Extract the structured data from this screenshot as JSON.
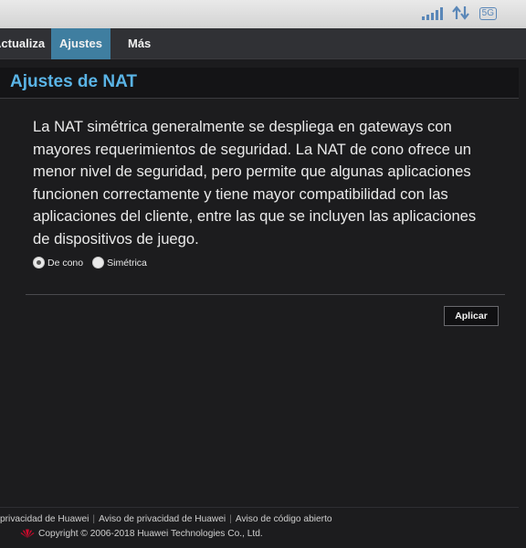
{
  "status_bar": {
    "icons": [
      "signal-bars-icon",
      "up-down-arrows-icon",
      "5g-badge-icon"
    ],
    "badge_5g": "5G",
    "accent_color": "#5a87b8"
  },
  "nav": {
    "items": [
      {
        "label": "Actualizar",
        "active": false
      },
      {
        "label": "Ajustes",
        "active": true
      },
      {
        "label": "Más",
        "active": false
      }
    ],
    "active_color": "#3f7ea0"
  },
  "page": {
    "title": "Ajustes de NAT",
    "title_color": "#5ab4e6",
    "description_lines": [
      "La NAT simétrica generalmente se despliega en gateways con",
      "mayores requerimientos de seguridad. La NAT de cono ofrece un",
      "menor nivel de seguridad, pero permite que algunas aplicaciones",
      "funcionen correctamente y tiene mayor compatibilidad con las",
      "aplicaciones del cliente, entre las que se incluyen las aplicaciones",
      "de dispositivos de juego."
    ]
  },
  "nat_type": {
    "options": [
      {
        "label": "De cono",
        "selected": true
      },
      {
        "label": "Simétrica",
        "selected": false
      }
    ]
  },
  "actions": {
    "apply_label": "Aplicar"
  },
  "footer": {
    "links": [
      "privacidad de Huawei",
      "Aviso de privacidad de Huawei",
      "Aviso de código abierto"
    ],
    "copyright": "Copyright © 2006-2018 Huawei Technologies Co., Ltd.",
    "logo_icon": "huawei-logo-icon",
    "logo_color": "#cf0a2c"
  }
}
